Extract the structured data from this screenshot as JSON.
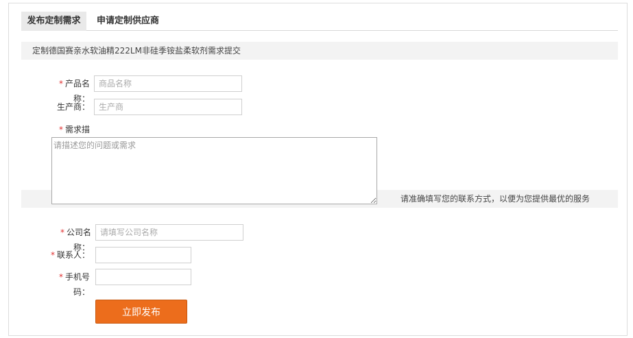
{
  "tabs": [
    {
      "label": "发布定制需求"
    },
    {
      "label": "申请定制供应商"
    }
  ],
  "form": {
    "intro": "定制德国赛亲水软油精222LM非硅季铵盐柔软剂需求提交",
    "required_mark": "*",
    "product_name": {
      "label_a": "产品名",
      "label_b": "称：",
      "placeholder": "商品名称"
    },
    "manufacturer": {
      "label": "生产商：",
      "placeholder": "生产商"
    },
    "description": {
      "label": "需求描",
      "placeholder": "请描述您的问题或需求"
    },
    "contact_notice": "请准确填写您的联系方式，以便为您提供最优的服务",
    "company_name": {
      "label_a": "公司名",
      "label_b": "称：",
      "placeholder": "请填写公司名称"
    },
    "contact_person": {
      "label": "联系人："
    },
    "phone": {
      "label_a": "手机号",
      "label_b": "码："
    },
    "submit_label": "立即发布"
  }
}
